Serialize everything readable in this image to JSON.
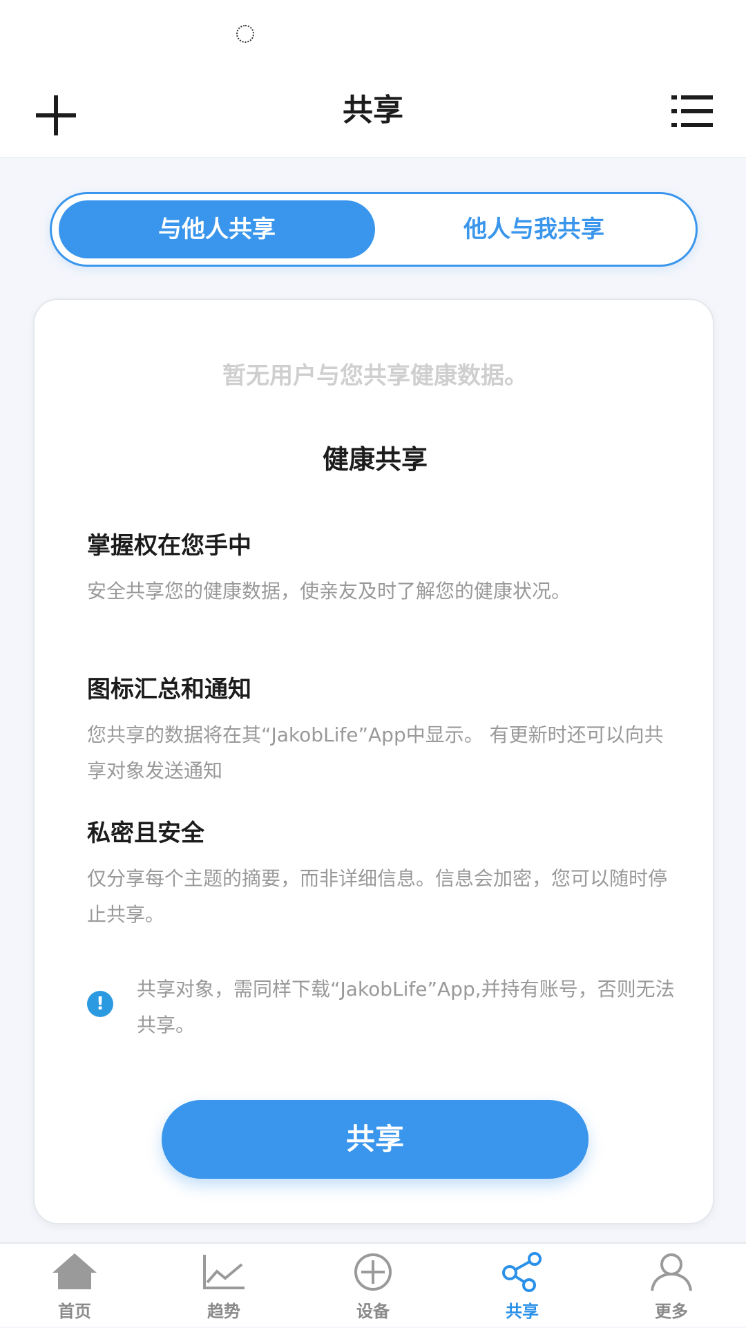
{
  "header": {
    "title": "共享"
  },
  "segment": {
    "active_label": "与他人共享",
    "inactive_label": "他人与我共享"
  },
  "card": {
    "empty_message": "暂无用户与您共享健康数据。",
    "title": "健康共享",
    "sections": [
      {
        "heading": "掌握权在您手中",
        "text": "安全共享您的健康数据，使亲友及时了解您的健康状况。"
      },
      {
        "heading": "图标汇总和通知",
        "text": "您共享的数据将在其“JakobLife”App中显示。 有更新时还可以向共享对象发送通知"
      },
      {
        "heading": "私密且安全",
        "text": "仅分享每个主题的摘要，而非详细信息。信息会加密，您可以随时停止共享。"
      }
    ],
    "notice": "共享对象，需同样下载“JakobLife”App,并持有账号，否则无法共享。",
    "notice_icon": "!",
    "share_button": "共享"
  },
  "tabs": [
    {
      "label": "首页",
      "icon": "home-icon",
      "active": false
    },
    {
      "label": "趋势",
      "icon": "trend-icon",
      "active": false
    },
    {
      "label": "设备",
      "icon": "add-circle-icon",
      "active": false
    },
    {
      "label": "共享",
      "icon": "share-icon",
      "active": true
    },
    {
      "label": "更多",
      "icon": "profile-icon",
      "active": false
    }
  ],
  "colors": {
    "accent": "#3a96ec",
    "inactive_tab": "#8a8a8a",
    "muted_text": "#999999"
  }
}
